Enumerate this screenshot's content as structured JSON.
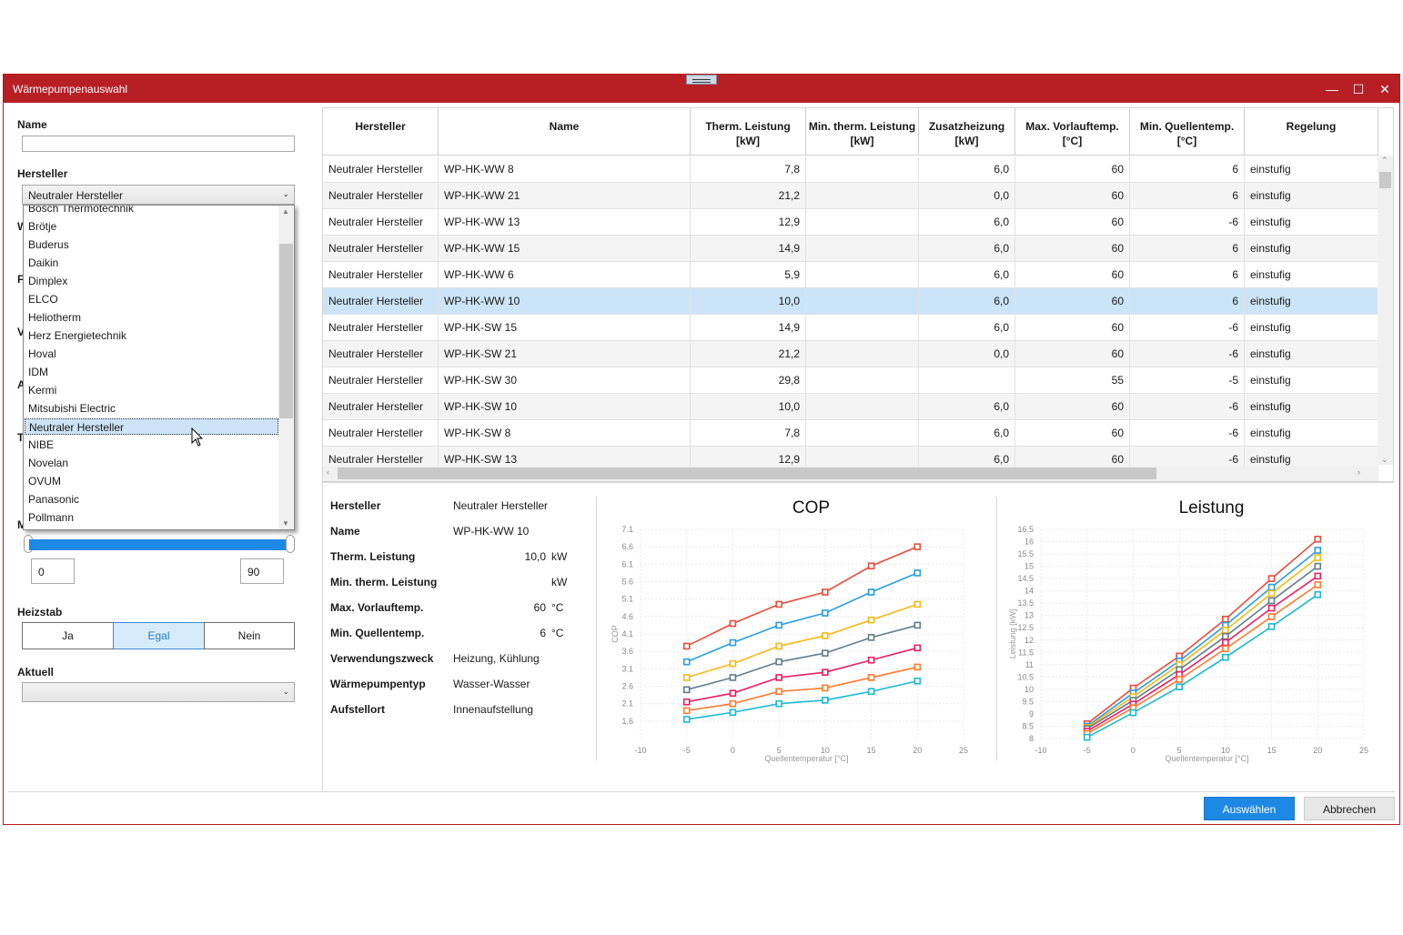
{
  "window": {
    "title": "Wärmepumpenauswahl"
  },
  "filter": {
    "name_label": "Name",
    "name_value": "",
    "hersteller_label": "Hersteller",
    "hersteller_value": "Neutraler Hersteller",
    "dropdown_items": [
      "Bosch Thermotechnik",
      "Brötje",
      "Buderus",
      "Daikin",
      "Dimplex",
      "ELCO",
      "Heliotherm",
      "Herz Energietechnik",
      "Hoval",
      "IDM",
      "Kermi",
      "Mitsubishi Electric",
      "Neutraler Hersteller",
      "NIBE",
      "Novelan",
      "OVUM",
      "Panasonic",
      "Pollmann"
    ],
    "dropdown_selected_index": 12,
    "hidden_label_initials": [
      "W",
      "F",
      "V",
      "A",
      "T",
      "M"
    ],
    "range_min": "0",
    "range_max": "90",
    "heizstab_label": "Heizstab",
    "heizstab_options": [
      "Ja",
      "Egal",
      "Nein"
    ],
    "heizstab_active": 1,
    "aktuell_label": "Aktuell",
    "aktuell_value": ""
  },
  "table": {
    "columns": [
      {
        "line1": "Hersteller",
        "line2": ""
      },
      {
        "line1": "Name",
        "line2": ""
      },
      {
        "line1": "Therm. Leistung",
        "line2": "[kW]"
      },
      {
        "line1": "Min. therm. Leistung",
        "line2": "[kW]"
      },
      {
        "line1": "Zusatzheizung",
        "line2": "[kW]"
      },
      {
        "line1": "Max. Vorlauftemp.",
        "line2": "[°C]"
      },
      {
        "line1": "Min. Quellentemp.",
        "line2": "[°C]"
      },
      {
        "line1": "Regelung",
        "line2": ""
      }
    ],
    "selected_row": 5,
    "rows": [
      [
        "Neutraler Hersteller",
        "WP-HK-WW 8",
        "7,8",
        "",
        "6,0",
        "60",
        "6",
        "einstufig"
      ],
      [
        "Neutraler Hersteller",
        "WP-HK-WW 21",
        "21,2",
        "",
        "0,0",
        "60",
        "6",
        "einstufig"
      ],
      [
        "Neutraler Hersteller",
        "WP-HK-WW 13",
        "12,9",
        "",
        "6,0",
        "60",
        "-6",
        "einstufig"
      ],
      [
        "Neutraler Hersteller",
        "WP-HK-WW 15",
        "14,9",
        "",
        "6,0",
        "60",
        "6",
        "einstufig"
      ],
      [
        "Neutraler Hersteller",
        "WP-HK-WW 6",
        "5,9",
        "",
        "6,0",
        "60",
        "6",
        "einstufig"
      ],
      [
        "Neutraler Hersteller",
        "WP-HK-WW 10",
        "10,0",
        "",
        "6,0",
        "60",
        "6",
        "einstufig"
      ],
      [
        "Neutraler Hersteller",
        "WP-HK-SW 15",
        "14,9",
        "",
        "6,0",
        "60",
        "-6",
        "einstufig"
      ],
      [
        "Neutraler Hersteller",
        "WP-HK-SW 21",
        "21,2",
        "",
        "0,0",
        "60",
        "-6",
        "einstufig"
      ],
      [
        "Neutraler Hersteller",
        "WP-HK-SW 30",
        "29,8",
        "",
        "",
        "55",
        "-5",
        "einstufig"
      ],
      [
        "Neutraler Hersteller",
        "WP-HK-SW 10",
        "10,0",
        "",
        "6,0",
        "60",
        "-6",
        "einstufig"
      ],
      [
        "Neutraler Hersteller",
        "WP-HK-SW 8",
        "7,8",
        "",
        "6,0",
        "60",
        "-6",
        "einstufig"
      ],
      [
        "Neutraler Hersteller",
        "WP-HK-SW 13",
        "12,9",
        "",
        "6,0",
        "60",
        "-6",
        "einstufig"
      ]
    ]
  },
  "details": {
    "hersteller_label": "Hersteller",
    "hersteller_value": "Neutraler Hersteller",
    "name_label": "Name",
    "name_value": "WP-HK-WW 10",
    "therm_label": "Therm. Leistung",
    "therm_value": "10,0",
    "therm_unit": "kW",
    "mintherm_label": "Min. therm. Leistung",
    "mintherm_value": "",
    "mintherm_unit": "kW",
    "vorlauf_label": "Max. Vorlauftemp.",
    "vorlauf_value": "60",
    "vorlauf_unit": "°C",
    "quelle_label": "Min. Quellentemp.",
    "quelle_value": "6",
    "quelle_unit": "°C",
    "zweck_label": "Verwendungszweck",
    "zweck_value": "Heizung, Kühlung",
    "typ_label": "Wärmepumpentyp",
    "typ_value": "Wasser-Wasser",
    "ort_label": "Aufstellort",
    "ort_value": "Innenaufstellung"
  },
  "buttons": {
    "select": "Auswählen",
    "cancel": "Abbrechen"
  },
  "chart_data": [
    {
      "type": "line",
      "title": "COP",
      "xlabel": "Quellentemperatur [°C]",
      "ylabel": "COP",
      "xlim": [
        -10,
        25
      ],
      "ylim": [
        1.1,
        7.1
      ],
      "xticks": [
        -10,
        -5,
        0,
        5,
        10,
        15,
        20,
        25
      ],
      "yticks": [
        1.6,
        2.1,
        2.6,
        3.1,
        3.6,
        4.1,
        4.6,
        5.1,
        5.6,
        6.1,
        6.6,
        7.1
      ],
      "x": [
        -5,
        0,
        5,
        10,
        15,
        20
      ],
      "series": [
        {
          "color": "#e74c3c",
          "values": [
            3.75,
            4.4,
            4.95,
            5.3,
            6.05,
            6.6
          ]
        },
        {
          "color": "#2a9de0",
          "values": [
            3.3,
            3.85,
            4.35,
            4.7,
            5.3,
            5.85
          ]
        },
        {
          "color": "#f5b915",
          "values": [
            2.85,
            3.25,
            3.75,
            4.05,
            4.5,
            4.95
          ]
        },
        {
          "color": "#607d8b",
          "values": [
            2.5,
            2.85,
            3.3,
            3.55,
            4.0,
            4.35
          ]
        },
        {
          "color": "#e91e63",
          "values": [
            2.15,
            2.4,
            2.85,
            3.0,
            3.35,
            3.7
          ]
        },
        {
          "color": "#ff7a2e",
          "values": [
            1.9,
            2.1,
            2.45,
            2.55,
            2.85,
            3.15
          ]
        },
        {
          "color": "#1ab9d0",
          "values": [
            1.65,
            1.85,
            2.1,
            2.2,
            2.45,
            2.75
          ]
        }
      ]
    },
    {
      "type": "line",
      "title": "Leistung",
      "xlabel": "Quellentemperatur [°C]",
      "ylabel": "Leistung [kW]",
      "xlim": [
        -10,
        25
      ],
      "ylim": [
        8,
        16.5
      ],
      "xticks": [
        -10,
        -5,
        0,
        5,
        10,
        15,
        20,
        25
      ],
      "yticks": [
        8,
        8.5,
        9,
        9.5,
        10,
        10.5,
        11,
        11.5,
        12,
        12.5,
        13,
        13.5,
        14,
        14.5,
        15,
        15.5,
        16,
        16.5
      ],
      "x": [
        -5,
        0,
        5,
        10,
        15,
        20
      ],
      "series": [
        {
          "color": "#e74c3c",
          "values": [
            8.6,
            10.05,
            11.35,
            12.85,
            14.5,
            16.1
          ]
        },
        {
          "color": "#2a9de0",
          "values": [
            8.5,
            9.85,
            11.15,
            12.6,
            14.15,
            15.65
          ]
        },
        {
          "color": "#f5b915",
          "values": [
            8.45,
            9.7,
            11.0,
            12.4,
            13.9,
            15.35
          ]
        },
        {
          "color": "#607d8b",
          "values": [
            8.4,
            9.55,
            10.8,
            12.15,
            13.6,
            15.0
          ]
        },
        {
          "color": "#e91e63",
          "values": [
            8.3,
            9.4,
            10.6,
            11.9,
            13.3,
            14.6
          ]
        },
        {
          "color": "#ff7a2e",
          "values": [
            8.2,
            9.25,
            10.4,
            11.65,
            12.95,
            14.25
          ]
        },
        {
          "color": "#1ab9d0",
          "values": [
            8.05,
            9.05,
            10.1,
            11.3,
            12.55,
            13.85
          ]
        }
      ]
    }
  ]
}
